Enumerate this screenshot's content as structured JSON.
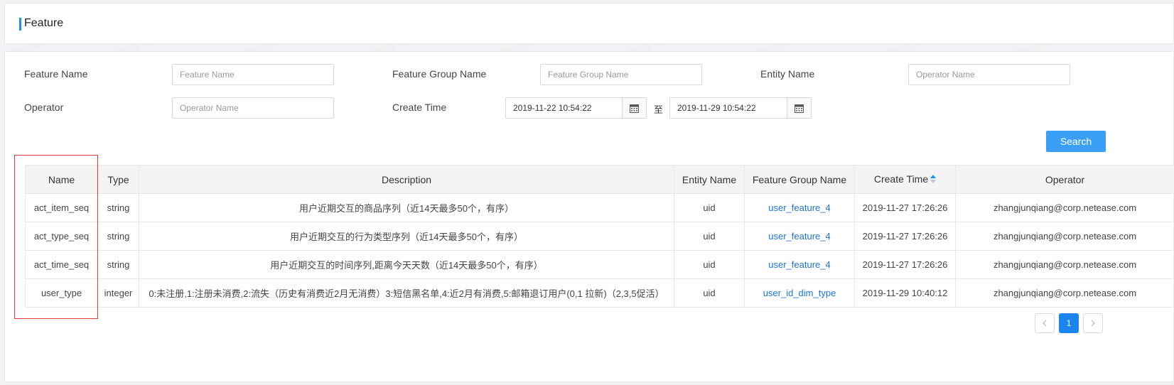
{
  "header": {
    "title": "Feature"
  },
  "filters": {
    "feature_name": {
      "label": "Feature Name",
      "placeholder": "Feature Name",
      "value": ""
    },
    "feature_group_name": {
      "label": "Feature Group Name",
      "placeholder": "Feature Group Name",
      "value": ""
    },
    "entity_name": {
      "label": "Entity Name",
      "placeholder": "Operator Name",
      "value": ""
    },
    "operator": {
      "label": "Operator",
      "placeholder": "Operator Name",
      "value": ""
    },
    "create_time": {
      "label": "Create Time",
      "start": "2019-11-22 10:54:22",
      "separator": "至",
      "end": "2019-11-29 10:54:22"
    }
  },
  "search_button": "Search",
  "table": {
    "columns": [
      "Name",
      "Type",
      "Description",
      "Entity Name",
      "Feature Group Name",
      "Create Time",
      "Operator"
    ],
    "sorted_column": "Create Time",
    "rows": [
      {
        "name": "act_item_seq",
        "type": "string",
        "description": "用户近期交互的商品序列（近14天最多50个，有序）",
        "entity": "uid",
        "group": "user_feature_4",
        "create_time": "2019-11-27 17:26:26",
        "operator": "zhangjunqiang@corp.netease.com"
      },
      {
        "name": "act_type_seq",
        "type": "string",
        "description": "用户近期交互的行为类型序列（近14天最多50个，有序）",
        "entity": "uid",
        "group": "user_feature_4",
        "create_time": "2019-11-27 17:26:26",
        "operator": "zhangjunqiang@corp.netease.com"
      },
      {
        "name": "act_time_seq",
        "type": "string",
        "description": "用户近期交互的时间序列,距离今天天数（近14天最多50个，有序）",
        "entity": "uid",
        "group": "user_feature_4",
        "create_time": "2019-11-27 17:26:26",
        "operator": "zhangjunqiang@corp.netease.com"
      },
      {
        "name": "user_type",
        "type": "integer",
        "description": "0:未注册,1:注册未消费,2:流失（历史有消费近2月无消费）3:短信黑名单,4:近2月有消费,5:邮箱退订用户(0,1 拉新)（2,3,5促活）",
        "entity": "uid",
        "group": "user_id_dim_type",
        "create_time": "2019-11-29 10:40:12",
        "operator": "zhangjunqiang@corp.netease.com"
      }
    ]
  },
  "pagination": {
    "prev": "<",
    "current": "1",
    "next": ">"
  },
  "watermark": "zhangjunqiang",
  "colors": {
    "accent": "#1890ff",
    "button": "#3a9ff5",
    "highlight": "#e53935",
    "link": "#1a73d9"
  }
}
